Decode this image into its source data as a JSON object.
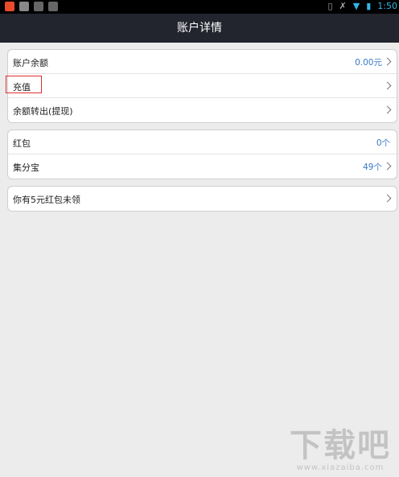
{
  "status_bar": {
    "time": "1:50"
  },
  "title": "账户详情",
  "groups": [
    {
      "rows": [
        {
          "label": "账户余额",
          "value": "0.00元"
        },
        {
          "label": "充值",
          "value": ""
        },
        {
          "label": "余额转出(提现)",
          "value": ""
        }
      ]
    },
    {
      "rows": [
        {
          "label": "红包",
          "value": "0个"
        },
        {
          "label": "集分宝",
          "value": "49个"
        }
      ]
    },
    {
      "rows": [
        {
          "label": "你有5元红包未领",
          "value": ""
        }
      ]
    }
  ],
  "watermark": {
    "big": "下载吧",
    "small": "www.xiazaiba.com"
  },
  "colors": {
    "title_bar": "#23252e",
    "value_text": "#3a78c2",
    "highlight": "#e03030",
    "background": "#ececec"
  }
}
